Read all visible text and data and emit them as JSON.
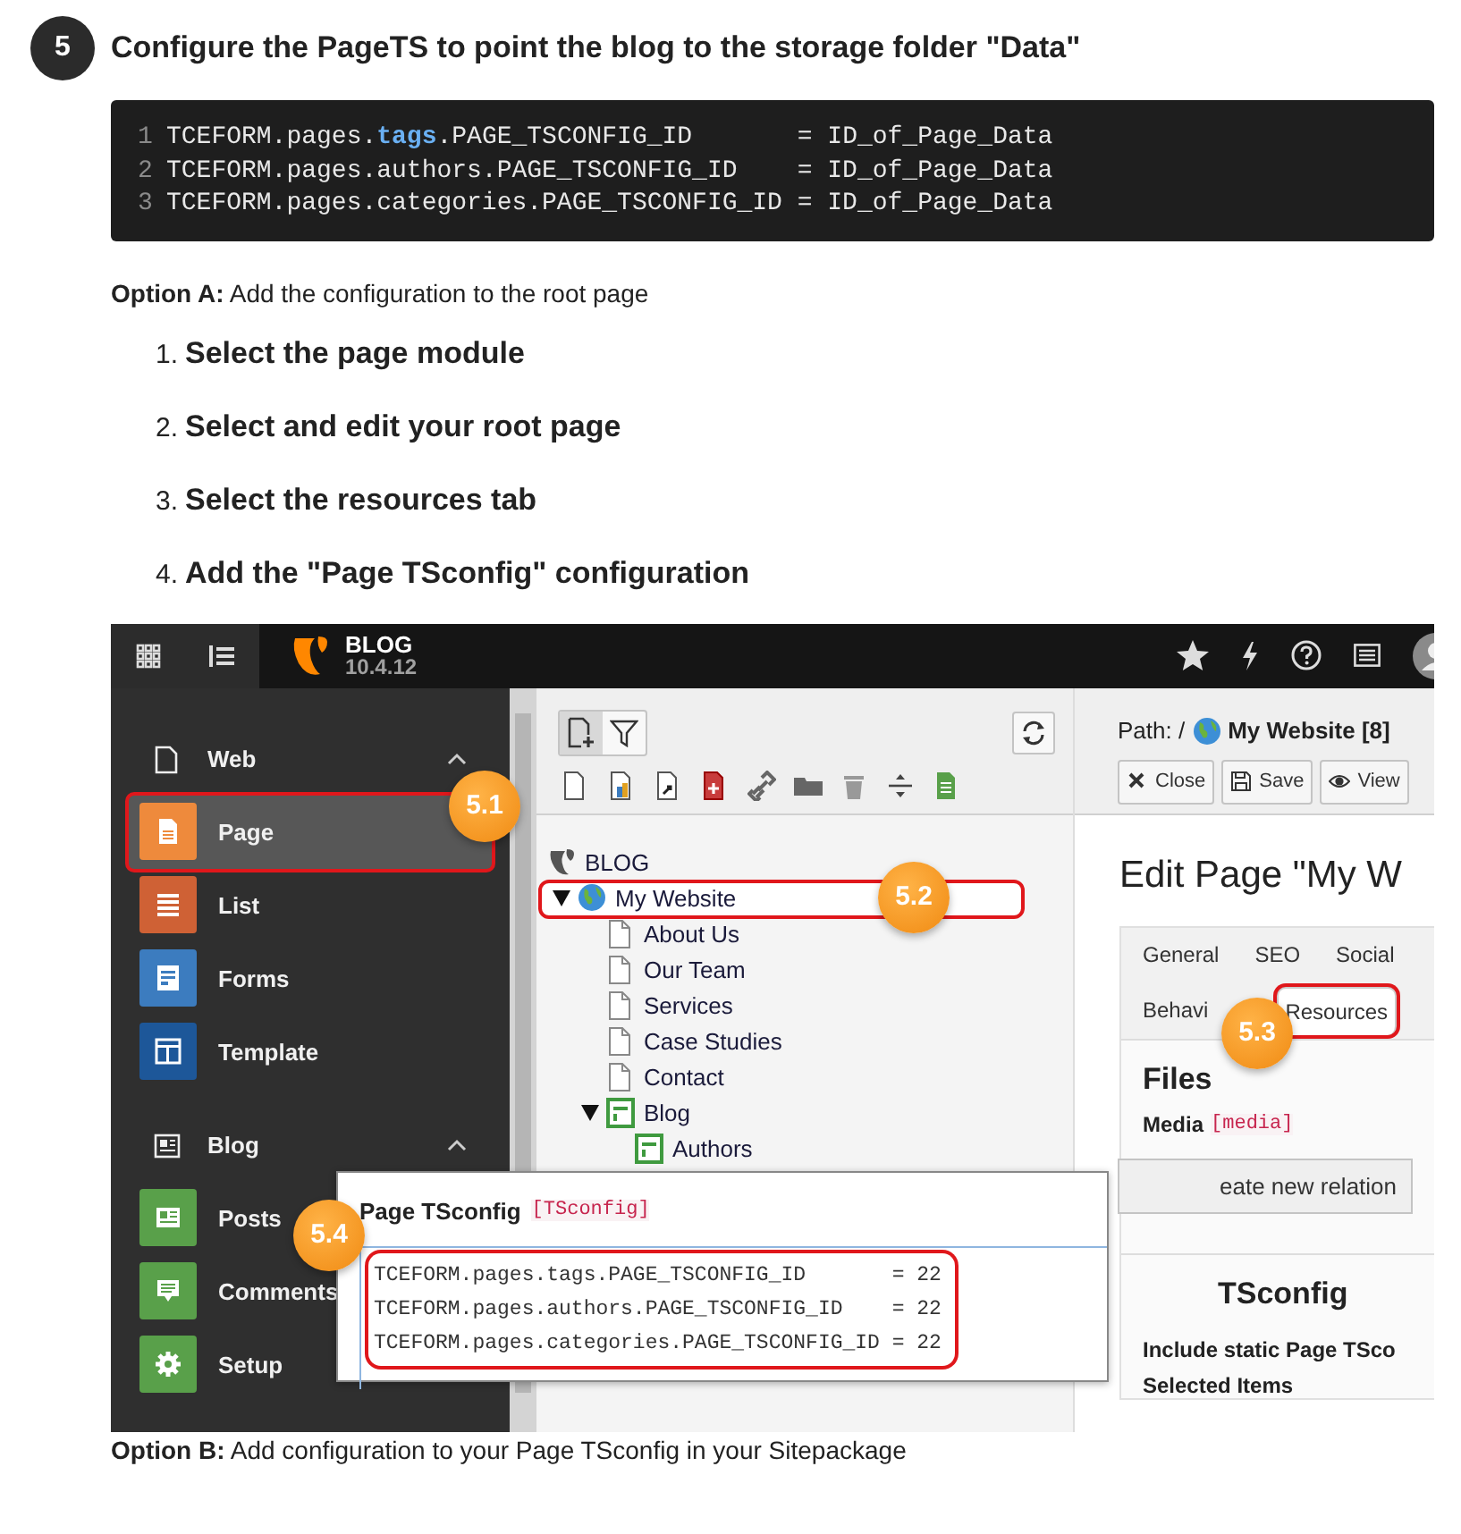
{
  "step": {
    "number": "5",
    "title": "Configure the PageTS to point the blog to the storage folder \"Data\""
  },
  "code": {
    "lines": [
      {
        "number": "1",
        "parts": [
          {
            "kind": "plain",
            "text": "TCEFORM.pages."
          },
          {
            "kind": "keyword",
            "text": "tags"
          },
          {
            "kind": "plain",
            "text": ".PAGE_TSCONFIG_ID       = ID_of_Page_Data"
          }
        ]
      },
      {
        "number": "2",
        "parts": [
          {
            "kind": "plain",
            "text": "TCEFORM.pages.authors.PAGE_TSCONFIG_ID    = ID_of_Page_Data"
          }
        ]
      },
      {
        "number": "3",
        "parts": [
          {
            "kind": "plain",
            "text": "TCEFORM.pages.categories.PAGE_TSCONFIG_ID = ID_of_Page_Data"
          }
        ]
      }
    ]
  },
  "option_a": "**Option A:** Add the configuration to the root page",
  "instructions": [
    {
      "number": "1.",
      "text": "Select the page module"
    },
    {
      "number": "2.",
      "text": "Select and edit your root page"
    },
    {
      "number": "3.",
      "text": "Select the resources tab"
    },
    {
      "number": "4.",
      "text": "Add the \"Page TSconfig\" configuration"
    }
  ],
  "screenshot": {
    "topbar": {
      "site_name": "BLOG",
      "version": "10.4.12"
    },
    "module_menu": [
      {
        "label": "Web",
        "expanded": true,
        "modules": [
          {
            "label": "Page",
            "color": "#ee8a3c",
            "selected": true,
            "highlighted": true,
            "callout": "5.1"
          },
          {
            "label": "List",
            "color": "#cf6135",
            "selected": false,
            "highlighted": false
          },
          {
            "label": "Forms",
            "color": "#3c7cbf",
            "selected": false,
            "highlighted": false
          },
          {
            "label": "Template",
            "color": "#1d5799",
            "selected": false,
            "highlighted": false
          }
        ]
      },
      {
        "label": "Blog",
        "expanded": true,
        "modules": [
          {
            "label": "Posts",
            "color": "#59a04a",
            "selected": false,
            "highlighted": false
          },
          {
            "label": "Comments",
            "color": "#59a04a",
            "selected": false,
            "highlighted": false
          },
          {
            "label": "Setup",
            "color": "#59a04a",
            "selected": false,
            "highlighted": false
          }
        ]
      }
    ],
    "page_tree": {
      "nodes": [
        {
          "kind": "root",
          "label": "BLOG",
          "selected": false,
          "highlighted": false,
          "children": [
            {
              "kind": "site",
              "label": "My Website",
              "expanded": true,
              "selected": true,
              "highlighted": true,
              "callout": "5.2",
              "children": [
                {
                  "kind": "page",
                  "label": "About Us",
                  "selected": false,
                  "highlighted": false
                },
                {
                  "kind": "page",
                  "label": "Our Team",
                  "selected": false,
                  "highlighted": false
                },
                {
                  "kind": "page",
                  "label": "Services",
                  "selected": false,
                  "highlighted": false
                },
                {
                  "kind": "page",
                  "label": "Case Studies",
                  "selected": false,
                  "highlighted": false
                },
                {
                  "kind": "page",
                  "label": "Contact",
                  "selected": false,
                  "highlighted": false
                },
                {
                  "kind": "folder",
                  "label": "Blog",
                  "expanded": true,
                  "selected": false,
                  "highlighted": false,
                  "children": [
                    {
                      "kind": "folder",
                      "label": "Authors",
                      "selected": false,
                      "highlighted": false
                    }
                  ]
                }
              ]
            }
          ]
        }
      ]
    },
    "editor": {
      "path_label": "Path: /",
      "path_page": "My Website [8]",
      "buttons": [
        "Close",
        "Save",
        "View"
      ],
      "heading": "Edit Page \"My W",
      "tab_rows": [
        {
          "tabs": [
            {
              "label": "General",
              "selected": false,
              "highlighted": false
            },
            {
              "label": "SEO",
              "selected": false,
              "highlighted": false
            },
            {
              "label": "Social",
              "selected": false,
              "highlighted": false
            }
          ]
        },
        {
          "tabs": [
            {
              "label": "Behavi",
              "selected": false,
              "highlighted": false
            },
            {
              "label": "Resources",
              "selected": true,
              "highlighted": true,
              "callout": "5.3"
            }
          ]
        }
      ],
      "files": {
        "title": "Files",
        "field_label": "Media",
        "field_id": "[media]",
        "button": "eate new relation"
      },
      "tsconfig": {
        "title": "TSconfig",
        "field_label": "Include static Page TSco",
        "sub_label": "Selected Items"
      }
    },
    "popup": {
      "title": "Page TSconfig",
      "field_id": "[TSconfig]",
      "highlighted": true,
      "callout": "5.4",
      "lines": [
        "TCEFORM.pages.tags.PAGE_TSCONFIG_ID       = 22",
        "TCEFORM.pages.authors.PAGE_TSCONFIG_ID    = 22",
        "TCEFORM.pages.categories.PAGE_TSCONFIG_ID = 22"
      ]
    }
  },
  "option_b": "**Option B:** Add configuration to your Page TSconfig in your Sitepackage"
}
